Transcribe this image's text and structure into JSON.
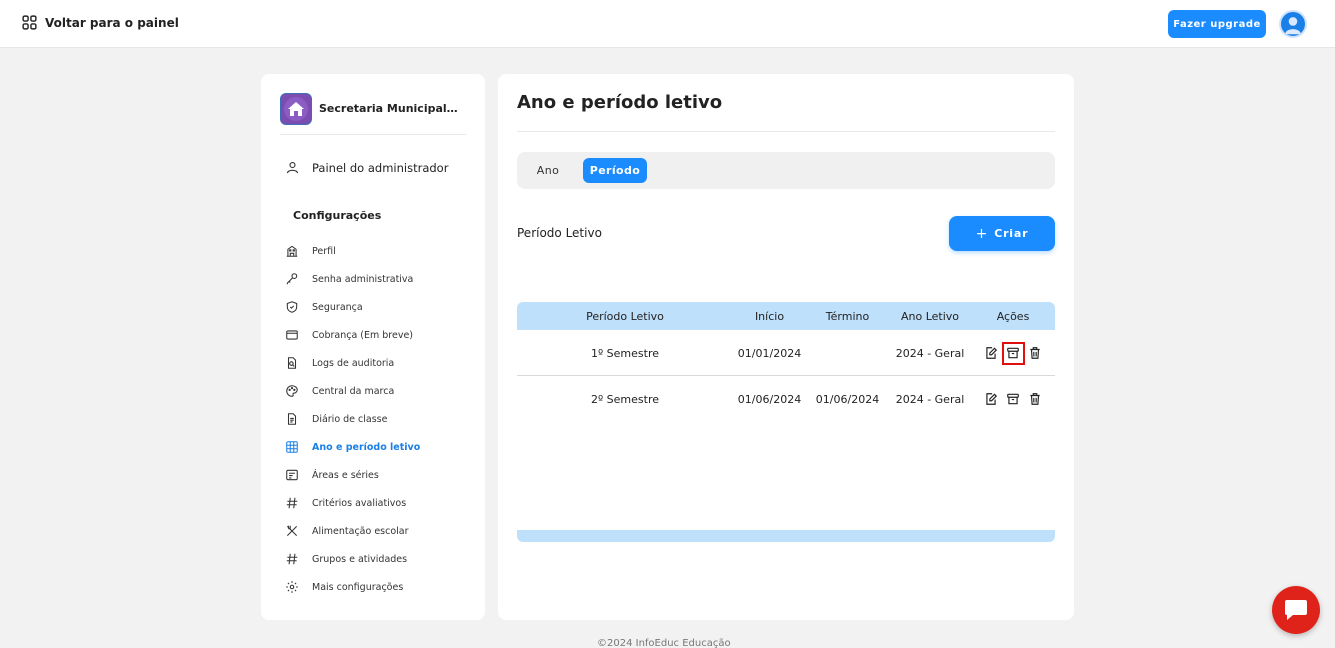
{
  "topbar": {
    "back_label": "Voltar para o painel",
    "upgrade_label": "Fazer upgrade"
  },
  "sidebar": {
    "org_name": "Secretaria Municipal de...",
    "admin_label": "Painel do administrador",
    "section_title": "Configurações",
    "items": [
      {
        "label": "Perfil",
        "icon": "building-icon"
      },
      {
        "label": "Senha administrativa",
        "icon": "key-icon"
      },
      {
        "label": "Segurança",
        "icon": "shield-icon"
      },
      {
        "label": "Cobrança (Em breve)",
        "icon": "card-icon"
      },
      {
        "label": "Logs de auditoria",
        "icon": "document-search-icon"
      },
      {
        "label": "Central da marca",
        "icon": "palette-icon"
      },
      {
        "label": "Diário de classe",
        "icon": "document-icon"
      },
      {
        "label": "Ano e período letivo",
        "icon": "calendar-grid-icon",
        "active": true
      },
      {
        "label": "Áreas e séries",
        "icon": "list-icon"
      },
      {
        "label": "Critérios avaliativos",
        "icon": "hash-icon"
      },
      {
        "label": "Alimentação escolar",
        "icon": "utensils-icon"
      },
      {
        "label": "Grupos e atividades",
        "icon": "hash-icon"
      },
      {
        "label": "Mais configurações",
        "icon": "gear-icon"
      }
    ]
  },
  "main": {
    "title": "Ano e período letivo",
    "tabs": [
      {
        "label": "Ano",
        "active": false
      },
      {
        "label": "Período",
        "active": true
      }
    ],
    "section_label": "Período Letivo",
    "create_label": "Criar",
    "table": {
      "headers": [
        "Período Letivo",
        "Início",
        "Término",
        "Ano Letivo",
        "Ações"
      ],
      "rows": [
        {
          "periodo": "1º Semestre",
          "inicio": "01/01/2024",
          "termino": "",
          "ano": "2024 - Geral"
        },
        {
          "periodo": "2º Semestre",
          "inicio": "01/06/2024",
          "termino": "01/06/2024",
          "ano": "2024 - Geral"
        }
      ]
    }
  },
  "footer": {
    "text": "©2024 InfoEduc Educação"
  },
  "colors": {
    "accent": "#1a8cff",
    "table_header": "#bfe0fb",
    "highlight": "#e01010",
    "chat": "#e0231a"
  }
}
